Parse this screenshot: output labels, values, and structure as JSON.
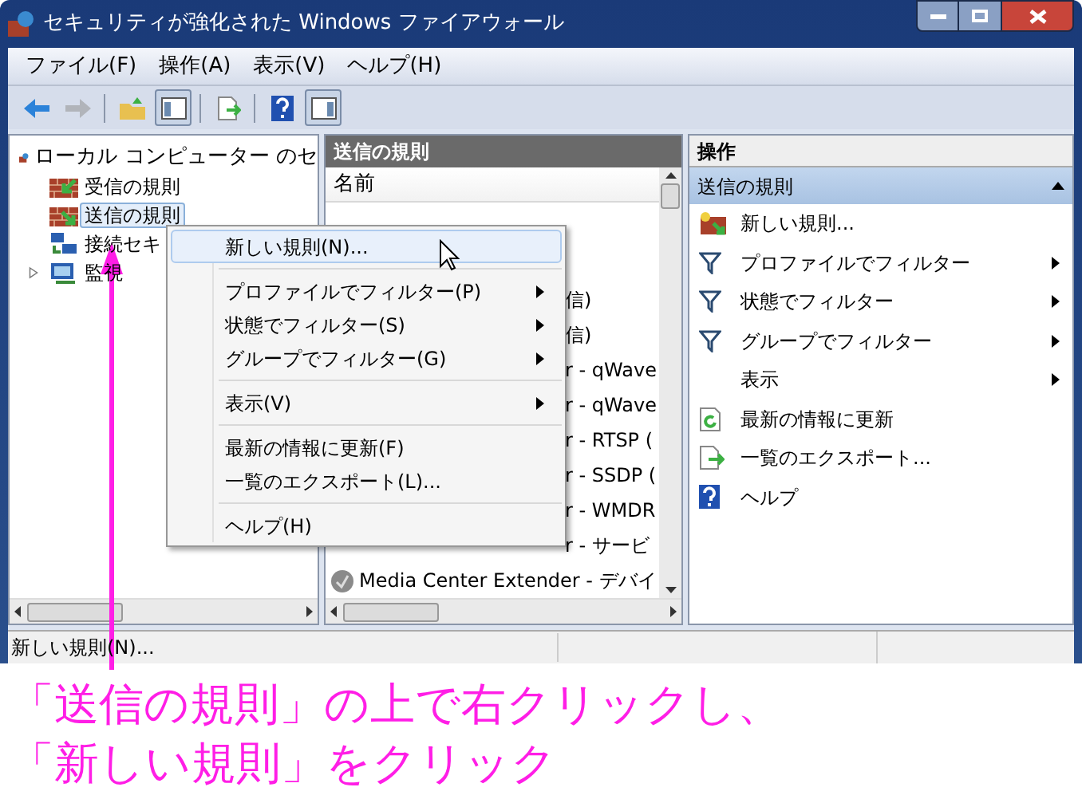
{
  "window": {
    "title": "セキュリティが強化された Windows ファイアウォール"
  },
  "menu_bar": [
    "ファイル(F)",
    "操作(A)",
    "表示(V)",
    "ヘルプ(H)"
  ],
  "toolbar": [
    {
      "kind": "back",
      "disabled": false,
      "pressed": false
    },
    {
      "kind": "forward",
      "disabled": true,
      "pressed": false
    },
    {
      "kind": "separator"
    },
    {
      "kind": "up",
      "disabled": false,
      "pressed": false
    },
    {
      "kind": "tree",
      "disabled": false,
      "pressed": true
    },
    {
      "kind": "separator"
    },
    {
      "kind": "export",
      "disabled": false,
      "pressed": false
    },
    {
      "kind": "separator"
    },
    {
      "kind": "help",
      "disabled": false,
      "pressed": false
    },
    {
      "kind": "actions",
      "disabled": false,
      "pressed": true
    }
  ],
  "tree": {
    "label": "ローカル コンピューター のセ",
    "children": [
      {
        "label": "受信の規則",
        "kind": "inbound",
        "selected": false
      },
      {
        "label": "送信の規則",
        "kind": "outbound",
        "selected": true
      },
      {
        "label": "接続セキ",
        "kind": "connection",
        "selected": false
      },
      {
        "label": "監視",
        "kind": "monitor",
        "selected": false,
        "expanded": false
      }
    ]
  },
  "rules_pane": {
    "title": "送信の規則",
    "columns": [
      "名前"
    ],
    "rows": [
      {
        "kind": "covered",
        "text": "信)"
      },
      {
        "kind": "covered",
        "text": "信)"
      },
      {
        "kind": "covered",
        "text": "r - qWave"
      },
      {
        "kind": "covered",
        "text": "r - qWave"
      },
      {
        "kind": "covered",
        "text": "r - RTSP ("
      },
      {
        "kind": "covered",
        "text": "r - SSDP ("
      },
      {
        "kind": "covered",
        "text": "r - WMDR"
      },
      {
        "kind": "covered",
        "text": "r - サービ"
      },
      {
        "kind": "full",
        "text": "Media Center Extender - デバイ"
      }
    ]
  },
  "context_menu": {
    "items": [
      {
        "kind": "item",
        "label": "新しい規則(N)...",
        "selected": true,
        "submenu": false
      },
      {
        "kind": "separator"
      },
      {
        "kind": "item",
        "label": "プロファイルでフィルター(P)",
        "selected": false,
        "submenu": true
      },
      {
        "kind": "item",
        "label": "状態でフィルター(S)",
        "selected": false,
        "submenu": true
      },
      {
        "kind": "item",
        "label": "グループでフィルター(G)",
        "selected": false,
        "submenu": true
      },
      {
        "kind": "separator"
      },
      {
        "kind": "item",
        "label": "表示(V)",
        "selected": false,
        "submenu": true
      },
      {
        "kind": "separator"
      },
      {
        "kind": "item",
        "label": "最新の情報に更新(F)",
        "selected": false,
        "submenu": false
      },
      {
        "kind": "item",
        "label": "一覧のエクスポート(L)...",
        "selected": false,
        "submenu": false
      },
      {
        "kind": "separator"
      },
      {
        "kind": "item",
        "label": "ヘルプ(H)",
        "selected": false,
        "submenu": false
      }
    ]
  },
  "actions_pane": {
    "title": "操作",
    "section": {
      "title": "送信の規則",
      "expanded": true
    },
    "items": [
      {
        "kind": "new",
        "label": "新しい規則...",
        "submenu": false
      },
      {
        "kind": "filter",
        "label": "プロファイルでフィルター",
        "submenu": true
      },
      {
        "kind": "filter",
        "label": "状態でフィルター",
        "submenu": true
      },
      {
        "kind": "filter",
        "label": "グループでフィルター",
        "submenu": true
      },
      {
        "kind": "plain",
        "label": "表示",
        "submenu": true
      },
      {
        "kind": "refresh",
        "label": "最新の情報に更新",
        "submenu": false
      },
      {
        "kind": "export",
        "label": "一覧のエクスポート...",
        "submenu": false
      },
      {
        "kind": "help",
        "label": "ヘルプ",
        "submenu": false
      }
    ]
  },
  "status_bar": {
    "text": "新しい規則(N)..."
  },
  "annotation": {
    "lines": [
      "「送信の規則」の上で右クリックし、",
      "「新しい規則」をクリック"
    ]
  }
}
